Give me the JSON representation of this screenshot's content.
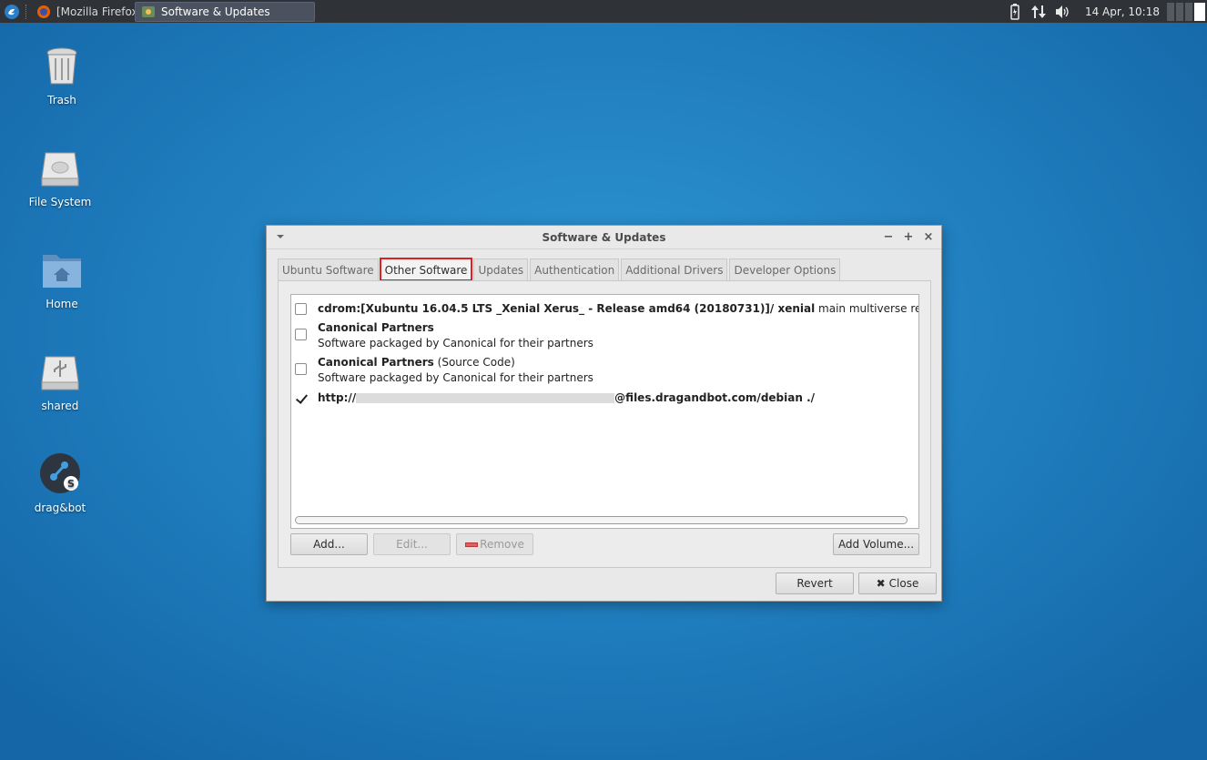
{
  "panel": {
    "tasks": [
      {
        "label": "[Mozilla Firefox]"
      },
      {
        "label": "Software & Updates"
      }
    ],
    "clock": "14 Apr, 10:18"
  },
  "desktop": {
    "icons": [
      {
        "label": "Trash"
      },
      {
        "label": "File System"
      },
      {
        "label": "Home"
      },
      {
        "label": "shared"
      },
      {
        "label": "drag&bot"
      }
    ]
  },
  "window": {
    "title": "Software & Updates",
    "tabs": [
      {
        "label": "Ubuntu Software"
      },
      {
        "label": "Other Software",
        "active": true
      },
      {
        "label": "Updates"
      },
      {
        "label": "Authentication"
      },
      {
        "label": "Additional Drivers"
      },
      {
        "label": "Developer Options"
      }
    ],
    "sources": [
      {
        "checked": false,
        "bold": "cdrom:[Xubuntu 16.04.5 LTS _Xenial Xerus_ - Release amd64 (20180731)]/ xenial",
        "rest": " main multiverse restricted univers"
      },
      {
        "checked": false,
        "bold": "Canonical Partners",
        "rest": "",
        "desc": "Software packaged by Canonical for their partners"
      },
      {
        "checked": false,
        "bold": "Canonical Partners",
        "rest": " (Source Code)",
        "desc": "Software packaged by Canonical for their partners"
      },
      {
        "checked": true,
        "bold_prefix": "http://",
        "bold_suffix": "@files.dragandbot.com/debian ./"
      }
    ],
    "buttons": {
      "add": "Add...",
      "edit": "Edit...",
      "remove": "Remove",
      "add_volume": "Add Volume...",
      "revert": "Revert",
      "close": "Close"
    }
  }
}
